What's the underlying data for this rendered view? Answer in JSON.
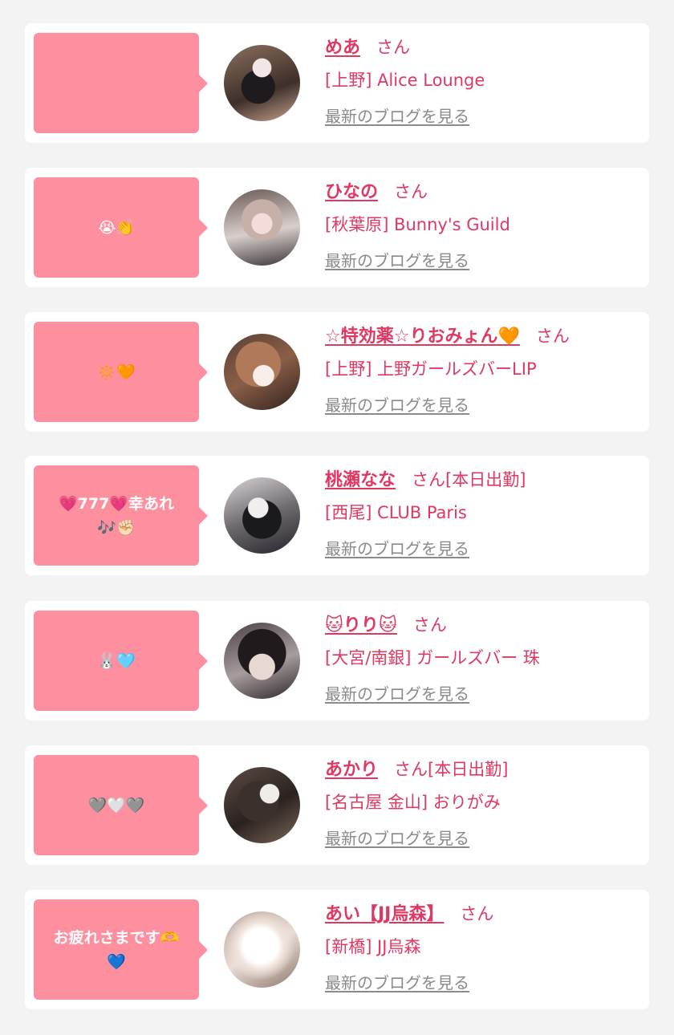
{
  "cards": [
    {
      "bubble_line1": "",
      "bubble_line2": "",
      "name": "めあ",
      "honorific": "さん",
      "shop": "[上野] Alice Lounge",
      "blog_link": "最新のブログを見る"
    },
    {
      "bubble_line1": "😭👏",
      "bubble_line2": "",
      "name": "ひなの",
      "honorific": "さん",
      "shop": "[秋葉原] Bunny's Guild",
      "blog_link": "最新のブログを見る"
    },
    {
      "bubble_line1": "🔅🧡",
      "bubble_line2": "",
      "name": "☆特効薬☆りおみょん🧡",
      "honorific": "さん",
      "shop": "[上野] 上野ガールズバーLIP",
      "blog_link": "最新のブログを見る"
    },
    {
      "bubble_line1": "💗777💗幸あれ",
      "bubble_line2": "🎶✊🏻",
      "name": "桃瀬なな",
      "honorific": "さん[本日出勤]",
      "shop": "[西尾] CLUB Paris",
      "blog_link": "最新のブログを見る"
    },
    {
      "bubble_line1": "🐰🩵",
      "bubble_line2": "",
      "name": "🐱りり🐱",
      "honorific": "さん",
      "shop": "[大宮/南銀] ガールズバー 珠",
      "blog_link": "最新のブログを見る"
    },
    {
      "bubble_line1": "🩶🤍🩶",
      "bubble_line2": "",
      "name": "あかり",
      "honorific": "さん[本日出勤]",
      "shop": "[名古屋 金山] おりがみ",
      "blog_link": "最新のブログを見る"
    },
    {
      "bubble_line1": "お疲れさまです🫶",
      "bubble_line2": "💙",
      "name": "あい【JJ烏森】",
      "honorific": "さん",
      "shop": "[新橋] JJ烏森",
      "blog_link": "最新のブログを見る"
    }
  ],
  "colors": {
    "accent": "#e03862",
    "bubble": "#fd8f9f",
    "link_gray": "#8a8a8a",
    "background": "#f3f3f3",
    "card": "#ffffff"
  },
  "icons": [
    "speech-bubble",
    "avatar-photo"
  ]
}
